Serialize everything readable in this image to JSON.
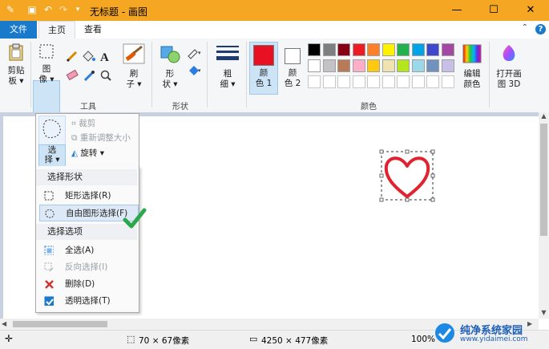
{
  "window": {
    "title": "无标题 - 画图",
    "minimize": "—",
    "maximize": "☐",
    "close": "✕"
  },
  "tabs": {
    "file": "文件",
    "home": "主页",
    "view": "查看",
    "help": "?"
  },
  "ribbon": {
    "clipboard": {
      "label_line1": "剪贴",
      "label_line2": "板 ▾"
    },
    "image": {
      "label_line1": "图",
      "label_line2": "像 ▾"
    },
    "tools": {
      "group_label": "工具"
    },
    "brush": {
      "label_line1": "刷",
      "label_line2": "子 ▾"
    },
    "shapes": {
      "label_line1": "形",
      "label_line2": "状 ▾",
      "group_label": "形状"
    },
    "size": {
      "label_line1": "粗",
      "label_line2": "细 ▾"
    },
    "color1": {
      "label_line1": "颜",
      "label_line2": "色 1",
      "value": "#e81123"
    },
    "color2": {
      "label_line1": "颜",
      "label_line2": "色 2",
      "value": "#ffffff"
    },
    "colors_group_label": "颜色",
    "edit_colors": {
      "label_line1": "编辑",
      "label_line2": "颜色"
    },
    "paint3d": {
      "label_line1": "打开画",
      "label_line2": "图 3D"
    },
    "palette_row1": [
      "#000000",
      "#7f7f7f",
      "#880015",
      "#ed1c24",
      "#ff7f27",
      "#fff200",
      "#22b14c",
      "#00a2e8",
      "#3f48cc",
      "#a349a4"
    ],
    "palette_row2": [
      "#ffffff",
      "#c3c3c3",
      "#b97a57",
      "#ffaec9",
      "#ffc90e",
      "#efe4b0",
      "#b5e61d",
      "#99d9ea",
      "#7092be",
      "#c8bfe7"
    ]
  },
  "image_menu": {
    "crop": "裁剪",
    "resize": "重新调整大小",
    "rotate": "旋转 ▾",
    "select_line1": "选",
    "select_line2": "择 ▾"
  },
  "dropdown": {
    "shape_header": "选择形状",
    "rect_select": "矩形选择(R)",
    "free_select": "自由图形选择(F)",
    "options_header": "选择选项",
    "select_all": "全选(A)",
    "invert": "反向选择(I)",
    "delete": "删除(D)",
    "transparent": "透明选择(T)"
  },
  "status": {
    "selection_size": "70 × 67像素",
    "canvas_size": "4250 × 477像素",
    "zoom": "100%"
  },
  "watermark": {
    "line1": "纯净系统家园",
    "line2": "www.yidaimei.com"
  },
  "colors": {
    "titlebar": "#f5a623",
    "accent": "#1979ca",
    "heart": "#e0232e",
    "check": "#2aa84a"
  }
}
